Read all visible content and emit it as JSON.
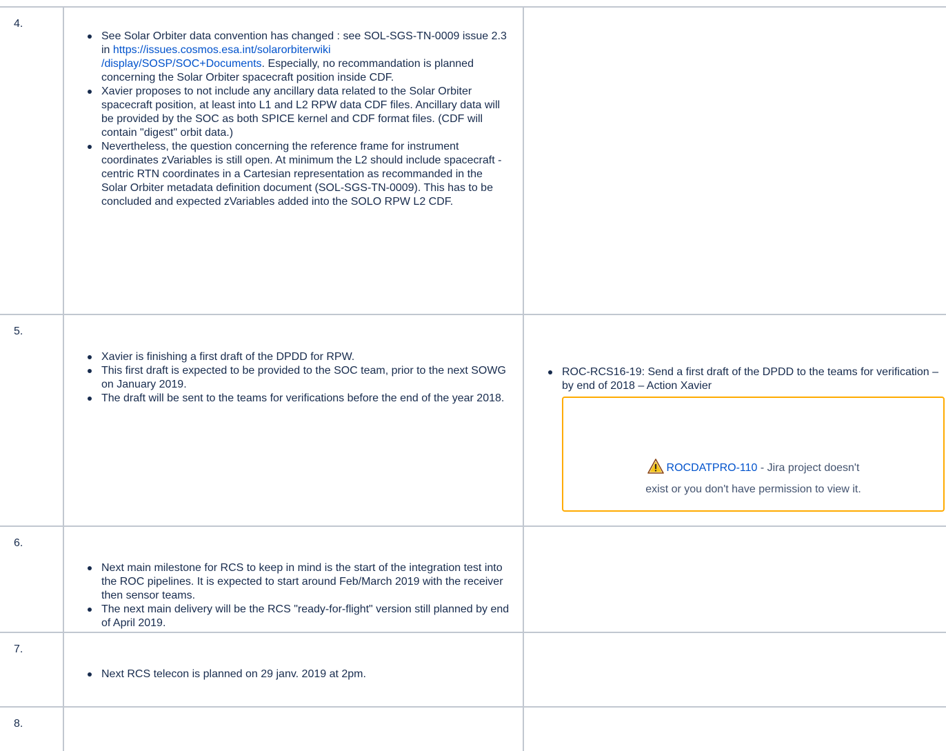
{
  "rows": [
    {
      "number": "4.",
      "items": [
        {
          "before": "See Solar Orbiter data convention has changed : see SOL-SGS-TN-0009 issue 2.3 in ",
          "link": "https://issues.cosmos.esa.int/solarorbiterwiki/display/SOSP/SOC+Documents",
          "link_line1": "https://issues.cosmos.esa.int/solarorbiterwiki",
          "link_line2": "/display/SOSP/SOC+Documents",
          "after": ". Especially, no recommandation is planned concerning the Solar Orbiter spacecraft position inside CDF."
        },
        {
          "text": "Xavier proposes to not include any ancillary data related to the Solar Orbiter spacecraft position, at least into L1 and L2 RPW data CDF files. Ancillary data will be provided by the SOC as both SPICE kernel and CDF format files. (CDF will contain \"digest\" orbit data.)"
        },
        {
          "text": "Nevertheless, the question concerning the reference frame for instrument coordinates zVariables is still open. At minimum the L2 should include spacecraft - centric RTN coordinates in a Cartesian representation as recommanded in the Solar Orbiter metadata definition document (SOL-SGS-TN-0009). This has to be concluded and expected zVariables added into the SOLO RPW L2 CDF."
        }
      ]
    },
    {
      "number": "5.",
      "items": [
        {
          "text": "Xavier is finishing a first draft of the DPDD for RPW."
        },
        {
          "text": "This first draft is expected to be provided to the SOC team, prior to the next SOWG on January 2019."
        },
        {
          "text": "The draft will be sent to the teams for verifications before the end of the year 2018."
        }
      ],
      "action": "ROC-RCS16-19: Send a first draft of the DPDD to the teams for verification – by end of 2018 – Action Xavier",
      "jira": {
        "icon": "warning-icon",
        "key": "ROCDATPRO-110",
        "message_part1": " - Jira project doesn't",
        "message_part2": "exist or you don't have permission to view it."
      }
    },
    {
      "number": "6.",
      "items": [
        {
          "text": "Next main milestone for RCS to keep in mind is the start of the integration test into the ROC pipelines. It is expected to start around Feb/March 2019 with the receiver then sensor teams."
        },
        {
          "text": "The next main delivery will be the RCS \"ready-for-flight\" version still planned by end of April 2019."
        }
      ]
    },
    {
      "number": "7.",
      "items": [
        {
          "text": "Next RCS telecon is planned on 29 janv. 2019 at 2pm."
        }
      ]
    },
    {
      "number": "8.",
      "items": []
    }
  ],
  "colors": {
    "text": "#172b4d",
    "link": "#0052cc",
    "border": "#c1c7d0",
    "warning": "#ffab00"
  }
}
